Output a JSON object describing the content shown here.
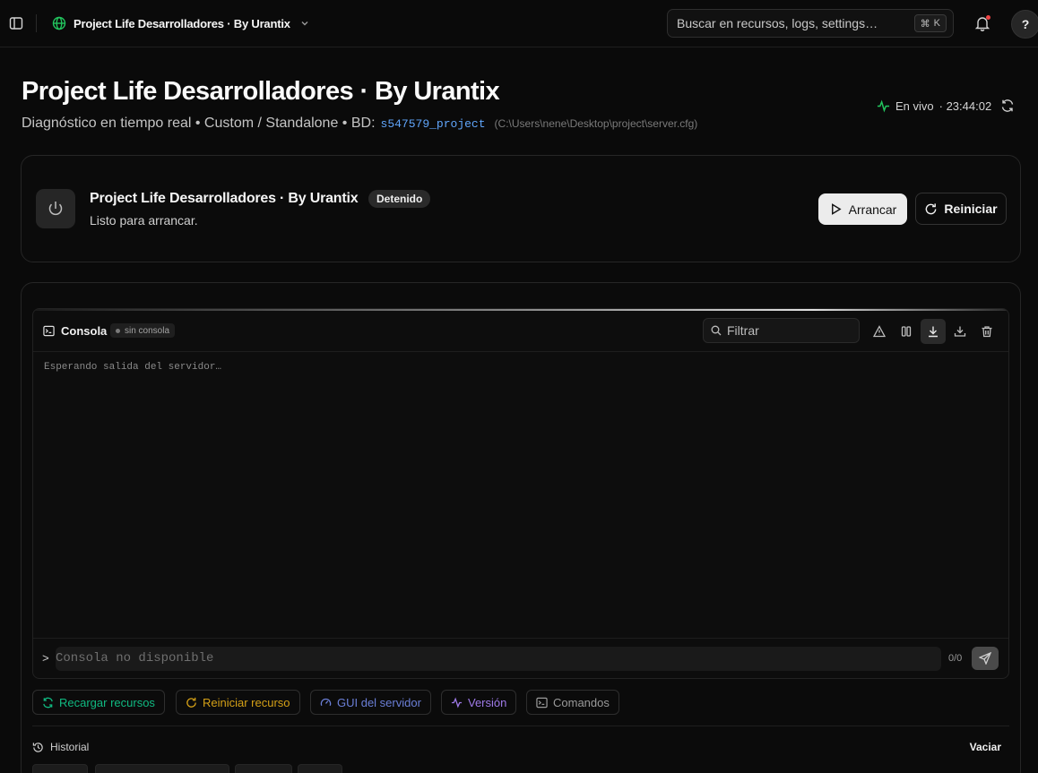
{
  "topbar": {
    "project_name": "Project Life Desarrolladores · By Urantix",
    "search_placeholder": "Buscar en recursos, logs, settings…",
    "shortcut_cmd": "⌘",
    "shortcut_key": "K",
    "help_label": "?"
  },
  "header": {
    "title": "Project Life Desarrolladores · By Urantix",
    "subtitle": "Diagnóstico en tiempo real • Custom / Standalone • BD:",
    "db_name": "s547579_project",
    "config_path": "(C:\\Users\\nene\\Desktop\\project\\server.cfg)",
    "live_label": "En vivo",
    "live_time": "· 23:44:02"
  },
  "server": {
    "name": "Project Life Desarrolladores · By Urantix",
    "state_badge": "Detenido",
    "status_text": "Listo para arrancar.",
    "start_label": "Arrancar",
    "restart_label": "Reiniciar"
  },
  "console": {
    "title": "Consola",
    "badge": "sin consola",
    "filter_placeholder": "Filtrar",
    "output_text": "Esperando salida del servidor…",
    "prompt": ">",
    "input_placeholder": "Consola no disponible",
    "counter": "0/0"
  },
  "actions": {
    "reload": "Recargar recursos",
    "restart_resource": "Reiniciar recurso",
    "gui": "GUI del servidor",
    "version": "Versión",
    "commands": "Comandos"
  },
  "history": {
    "title": "Historial",
    "clear_label": "Vaciar"
  },
  "colors": {
    "accent_green": "#22c55e",
    "db_blue": "#60a5fa",
    "reload_green": "#10b981",
    "restart_amber": "#d4a017",
    "gui_blue": "#6b7fd7",
    "version_purple": "#9f7ae8"
  }
}
